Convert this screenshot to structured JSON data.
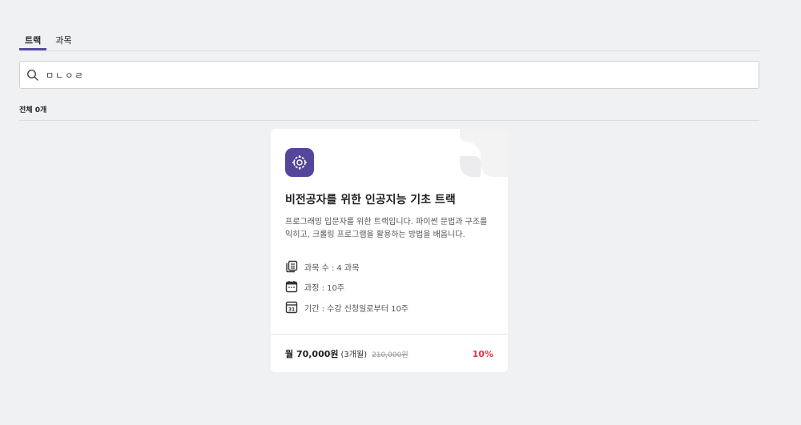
{
  "tabs": [
    {
      "label": "트랙",
      "active": true
    },
    {
      "label": "과목",
      "active": false
    }
  ],
  "search": {
    "value": "ㅁㄴㅇㄹ",
    "placeholder": ""
  },
  "result_count": "전체 0개",
  "card": {
    "title": "비전공자를 위한 인공지능 기초 트랙",
    "description": "프로그래밍 입문자를 위한 트랙입니다. 파이썬 문법과 구조를 익히고, 크롤링 프로그램을 활용하는 방법을 배웁니다.",
    "info": [
      {
        "icon": "book-stack-icon",
        "text": "과목 수 : 4 과목"
      },
      {
        "icon": "calendar-icon",
        "text": "과정 : 10주"
      },
      {
        "icon": "calendar-date-icon",
        "text": "기간 : 수강 신청일로부터 10주"
      }
    ],
    "price": {
      "main": "월 70,000원",
      "period": "(3개월)",
      "original": "210,000원",
      "discount": "10%"
    },
    "logo_color": "#55469b"
  },
  "colors": {
    "accent": "#5b4ca0",
    "discount": "#e5344c"
  }
}
